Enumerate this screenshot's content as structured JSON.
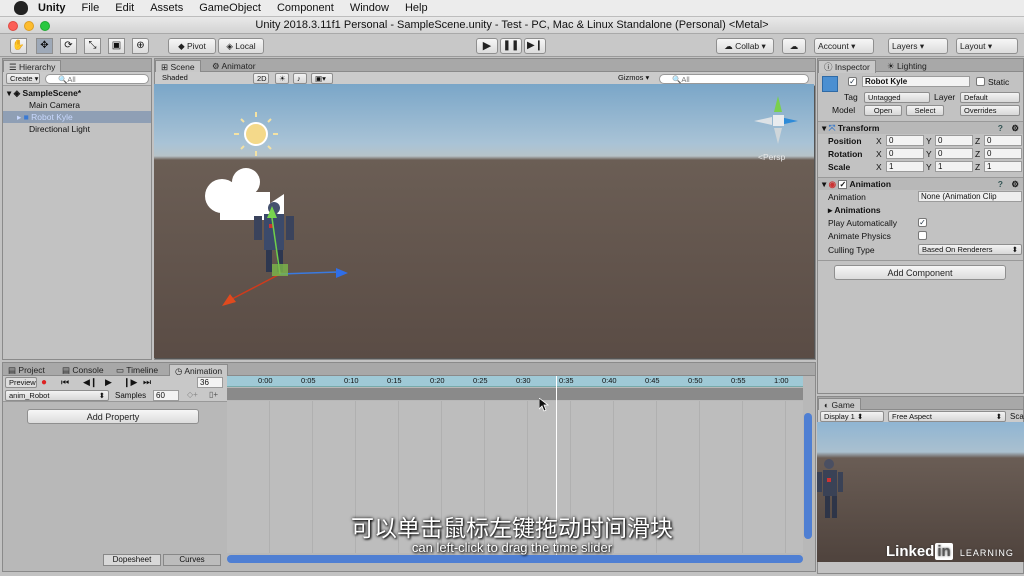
{
  "menubar": {
    "items": [
      "Unity",
      "File",
      "Edit",
      "Assets",
      "GameObject",
      "Component",
      "Window",
      "Help"
    ]
  },
  "window": {
    "title": "Unity 2018.3.11f1 Personal - SampleScene.unity - Test - PC, Mac & Linux Standalone (Personal) <Metal>"
  },
  "toolbar": {
    "pivot": "Pivot",
    "local": "Local",
    "collab": "Collab",
    "account": "Account",
    "layers": "Layers",
    "layout": "Layout"
  },
  "hierarchy": {
    "tab": "Hierarchy",
    "create": "Create",
    "search_placeholder": "All",
    "scene": "SampleScene*",
    "items": [
      "Main Camera",
      "Robot Kyle",
      "Directional Light"
    ]
  },
  "scene_view": {
    "tabs": [
      "Scene",
      "Animator"
    ],
    "shading": "Shaded",
    "mode_2d": "2D",
    "gizmos": "Gizmos",
    "search_placeholder": "All",
    "persp": "Persp"
  },
  "inspector": {
    "tabs": [
      "Inspector",
      "Lighting"
    ],
    "object_name": "Robot Kyle",
    "static_label": "Static",
    "tag_label": "Tag",
    "tag_value": "Untagged",
    "layer_label": "Layer",
    "layer_value": "Default",
    "model_label": "Model",
    "open": "Open",
    "select": "Select",
    "overrides": "Overrides",
    "transform": {
      "title": "Transform",
      "rows": [
        {
          "label": "Position",
          "x": "0",
          "y": "0",
          "z": "0"
        },
        {
          "label": "Rotation",
          "x": "0",
          "y": "0",
          "z": "0"
        },
        {
          "label": "Scale",
          "x": "1",
          "y": "1",
          "z": "1"
        }
      ]
    },
    "animation": {
      "title": "Animation",
      "clip_label": "Animation",
      "clip_value": "None (Animation Clip",
      "animations_label": "Animations",
      "play_auto": "Play Automatically",
      "physics": "Animate Physics",
      "culling_label": "Culling Type",
      "culling_value": "Based On Renderers"
    },
    "add_component": "Add Component"
  },
  "bottom": {
    "tabs": [
      "Project",
      "Console",
      "Timeline",
      "Animation"
    ],
    "preview": "Preview",
    "frame": "36",
    "clip": "anim_Robot",
    "samples_label": "Samples",
    "samples_value": "60",
    "add_property": "Add Property",
    "ticks": [
      "0:00",
      "0:05",
      "0:10",
      "0:15",
      "0:20",
      "0:25",
      "0:30",
      "0:35",
      "0:40",
      "0:45",
      "0:50",
      "0:55",
      "1:00"
    ],
    "dopesheet": "Dopesheet",
    "curves": "Curves"
  },
  "game": {
    "tab": "Game",
    "display": "Display 1",
    "aspect": "Free Aspect",
    "scale": "Sca"
  },
  "subtitle": {
    "cn": "可以单击鼠标左键拖动时间滑块",
    "en": "can left-click to drag the time slider"
  },
  "watermark": {
    "brand": "Linked",
    "in": "in",
    "learning": "LEARNING"
  }
}
